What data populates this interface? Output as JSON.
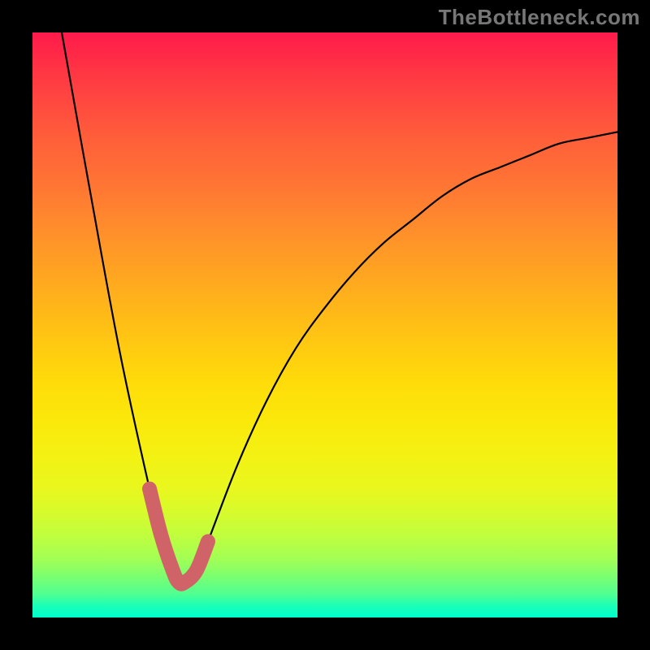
{
  "attribution": "TheBottleneck.com",
  "colors": {
    "frame": "#000000",
    "curve_main": "#000000",
    "curve_highlight": "#cf6367",
    "gradient_top": "#ff1a4b",
    "gradient_bottom": "#00ffcc"
  },
  "chart_data": {
    "type": "line",
    "title": "",
    "xlabel": "",
    "ylabel": "",
    "xlim": [
      0,
      100
    ],
    "ylim": [
      0,
      100
    ],
    "grid": false,
    "legend": false,
    "series": [
      {
        "name": "bottleneck-curve",
        "x": [
          5,
          10,
          15,
          20,
          22,
          24,
          25,
          26,
          28,
          30,
          35,
          40,
          45,
          50,
          55,
          60,
          65,
          70,
          75,
          80,
          85,
          90,
          95,
          100
        ],
        "y": [
          100,
          72,
          45,
          22,
          14,
          8,
          6,
          6,
          8,
          13,
          26,
          37,
          46,
          53,
          59,
          64,
          68,
          72,
          75,
          77,
          79,
          81,
          82,
          83
        ]
      },
      {
        "name": "highlight-segment",
        "x": [
          20,
          22,
          24,
          25,
          26,
          28,
          30
        ],
        "y": [
          22,
          14,
          8,
          6,
          6,
          8,
          13
        ]
      }
    ],
    "minimum": {
      "x": 25.5,
      "y": 6
    }
  }
}
